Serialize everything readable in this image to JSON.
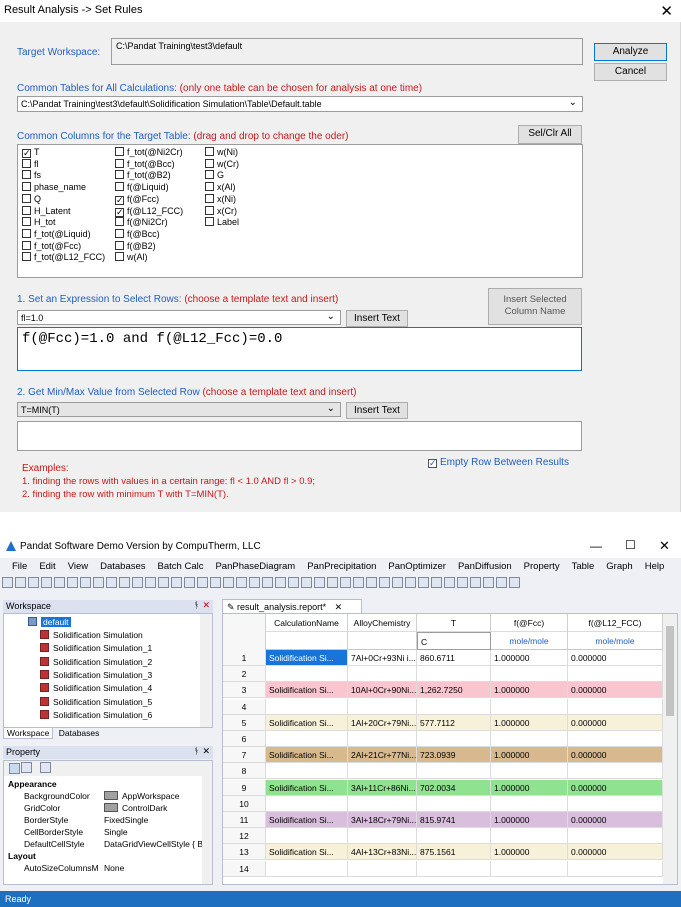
{
  "dialog": {
    "title": "Result Analysis -> Set Rules",
    "close_glyph": "✕",
    "target_workspace_label": "Target Workspace:",
    "target_workspace_value": "C:\\Pandat Training\\test3\\default",
    "analyze_label": "Analyze",
    "cancel_label": "Cancel",
    "common_tables_label": "Common Tables for All Calculations:",
    "common_tables_note": "(only one table can be chosen for analysis at one time)",
    "table_path": "C:\\Pandat Training\\test3\\default\\Solidification Simulation\\Table\\Default.table",
    "common_columns_label": "Common Columns for the Target Table:",
    "common_columns_note": "(drag and drop to change the oder)",
    "setclr_label": "Sel/Clr All",
    "columns_col1": [
      {
        "t": "T",
        "c": true
      },
      {
        "t": "fl",
        "c": false
      },
      {
        "t": "fs",
        "c": false
      },
      {
        "t": "phase_name",
        "c": false
      },
      {
        "t": "Q",
        "c": false
      },
      {
        "t": "H_Latent",
        "c": false
      },
      {
        "t": "H_tot",
        "c": false
      },
      {
        "t": "f_tot(@Liquid)",
        "c": false
      },
      {
        "t": "f_tot(@Fcc)",
        "c": false
      },
      {
        "t": "f_tot(@L12_FCC)",
        "c": false
      }
    ],
    "columns_col2": [
      {
        "t": "f_tot(@Ni2Cr)",
        "c": false
      },
      {
        "t": "f_tot(@Bcc)",
        "c": false
      },
      {
        "t": "f_tot(@B2)",
        "c": false
      },
      {
        "t": "f(@Liquid)",
        "c": false
      },
      {
        "t": "f(@Fcc)",
        "c": true
      },
      {
        "t": "f(@L12_FCC)",
        "c": true
      },
      {
        "t": "f(@Ni2Cr)",
        "c": false
      },
      {
        "t": "f(@Bcc)",
        "c": false
      },
      {
        "t": "f(@B2)",
        "c": false
      },
      {
        "t": "w(Al)",
        "c": false
      }
    ],
    "columns_col3": [
      {
        "t": "w(Ni)",
        "c": false
      },
      {
        "t": "w(Cr)",
        "c": false
      },
      {
        "t": "G",
        "c": false
      },
      {
        "t": "x(Al)",
        "c": false
      },
      {
        "t": "x(Ni)",
        "c": false
      },
      {
        "t": "x(Cr)",
        "c": false
      },
      {
        "t": "Label",
        "c": false
      }
    ],
    "expr_label": "1. Set an Expression to Select Rows:",
    "expr_note": "(choose a template text and insert)",
    "expr_template": "fl=1.0",
    "insert_text_label": "Insert Text",
    "insert_selected_label": "Insert Selected Column Name",
    "expression": "f(@Fcc)=1.0 and f(@L12_Fcc)=0.0",
    "minmax_label": "2. Get Min/Max Value from Selected Row",
    "minmax_note": "(choose a template text and insert)",
    "minmax_template": "T=MIN(T)",
    "insert_text_label2": "Insert Text",
    "minmax_value": "",
    "empty_row_label": "Empty Row Between Results",
    "empty_row_checked": true,
    "examples_title": "Examples:",
    "example1": "1. finding the rows with values in a certain range: fl < 1.0 AND fl > 0.9;",
    "example2": "2. finding the row with minimum T with T=MIN(T)."
  },
  "app": {
    "title": "Pandat Software Demo Version by CompuTherm, LLC",
    "menu": [
      "File",
      "Edit",
      "View",
      "Databases",
      "Batch Calc",
      "PanPhaseDiagram",
      "PanPrecipitation",
      "PanOptimizer",
      "PanDiffusion",
      "Property",
      "Table",
      "Graph",
      "Help"
    ],
    "workspace_title": "Workspace",
    "tree_root": "default",
    "tree_items": [
      "Solidification Simulation",
      "Solidification Simulation_1",
      "Solidification Simulation_2",
      "Solidification Simulation_3",
      "Solidification Simulation_4",
      "Solidification Simulation_5",
      "Solidification Simulation_6"
    ],
    "ws_tab1": "Workspace",
    "ws_tab2": "Databases",
    "property_title": "Property",
    "prop_sec1": "Appearance",
    "props": [
      {
        "k": "BackgroundColor",
        "v": "AppWorkspace",
        "sw": "#a0a0a0"
      },
      {
        "k": "GridColor",
        "v": "ControlDark",
        "sw": "#a0a0a0"
      },
      {
        "k": "BorderStyle",
        "v": "FixedSingle",
        "sw": ""
      },
      {
        "k": "CellBorderStyle",
        "v": "Single",
        "sw": ""
      },
      {
        "k": "DefaultCellStyle",
        "v": "DataGridViewCellStyle { B:",
        "sw": ""
      }
    ],
    "prop_sec2": "Layout",
    "props2": [
      {
        "k": "AutoSizeColumnsM",
        "v": "None"
      }
    ],
    "doc_tab": "result_analysis.report*",
    "headers": [
      "CalculationName",
      "AlloyChemistry",
      "T",
      "f(@Fcc)",
      "f(@L12_FCC)"
    ],
    "units": [
      "",
      "",
      "C",
      "mole/mole",
      "mole/mole"
    ],
    "rows": [
      {
        "n": "1",
        "cells": [
          "Solidification Si...",
          "7Al+0Cr+93Ni i...",
          "860.6711",
          "1.000000",
          "0.000000"
        ],
        "bg": "#ffffff",
        "sel": true
      },
      {
        "n": "2",
        "cells": [
          "",
          "",
          "",
          "",
          ""
        ],
        "bg": "#ffffff",
        "sel": false
      },
      {
        "n": "3",
        "cells": [
          "Solidification Si...",
          "10Al+0Cr+90Ni...",
          "1,262.7250",
          "1.000000",
          "0.000000"
        ],
        "bg": "#f9c6d0",
        "sel": false
      },
      {
        "n": "4",
        "cells": [
          "",
          "",
          "",
          "",
          ""
        ],
        "bg": "#ffffff",
        "sel": false
      },
      {
        "n": "5",
        "cells": [
          "Solidification Si...",
          "1Al+20Cr+79Ni...",
          "577.7112",
          "1.000000",
          "0.000000"
        ],
        "bg": "#f7f1d9",
        "sel": false
      },
      {
        "n": "6",
        "cells": [
          "",
          "",
          "",
          "",
          ""
        ],
        "bg": "#ffffff",
        "sel": false
      },
      {
        "n": "7",
        "cells": [
          "Solidification Si...",
          "2Al+21Cr+77Ni...",
          "723.0939",
          "1.000000",
          "0.000000"
        ],
        "bg": "#d8b98e",
        "sel": false
      },
      {
        "n": "8",
        "cells": [
          "",
          "",
          "",
          "",
          ""
        ],
        "bg": "#ffffff",
        "sel": false
      },
      {
        "n": "9",
        "cells": [
          "Solidification Si...",
          "3Al+11Cr+86Ni...",
          "702.0034",
          "1.000000",
          "0.000000"
        ],
        "bg": "#8fe28f",
        "sel": false
      },
      {
        "n": "10",
        "cells": [
          "",
          "",
          "",
          "",
          ""
        ],
        "bg": "#ffffff",
        "sel": false
      },
      {
        "n": "11",
        "cells": [
          "Solidification Si...",
          "3Al+18Cr+79Ni...",
          "815.9741",
          "1.000000",
          "0.000000"
        ],
        "bg": "#d9bfdd",
        "sel": false
      },
      {
        "n": "12",
        "cells": [
          "",
          "",
          "",
          "",
          ""
        ],
        "bg": "#ffffff",
        "sel": false
      },
      {
        "n": "13",
        "cells": [
          "Solidification Si...",
          "4Al+13Cr+83Ni...",
          "875.1561",
          "1.000000",
          "0.000000"
        ],
        "bg": "#f7f1d9",
        "sel": false
      },
      {
        "n": "14",
        "cells": [
          "",
          "",
          "",
          "",
          ""
        ],
        "bg": "#ffffff",
        "sel": false
      }
    ],
    "status": "Ready"
  }
}
